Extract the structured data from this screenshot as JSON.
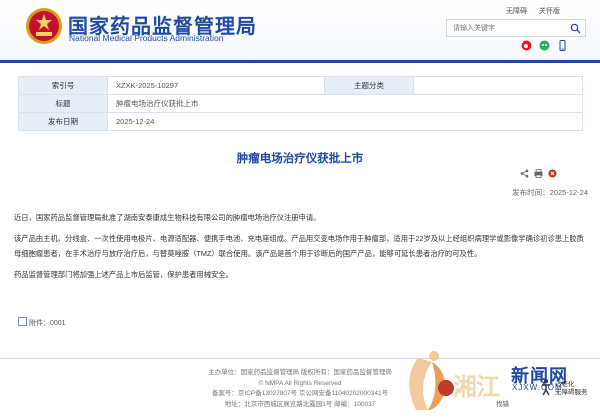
{
  "header": {
    "site_name": "国家药品监督管理局",
    "site_name_en": "National Medical Products Administration",
    "top_links": [
      "无障碍",
      "关怀版"
    ],
    "search_placeholder": "请输入关键字"
  },
  "info": {
    "rows": [
      {
        "label": "索引号",
        "value": "XZXK-2025-10297",
        "label2": "主题分类",
        "value2": ""
      },
      {
        "label": "标题",
        "value": "肿瘤电场治疗仪获批上市"
      },
      {
        "label": "发布日期",
        "value": "2025-12-24"
      }
    ]
  },
  "article": {
    "title": "肿瘤电场治疗仪获批上市",
    "date": "发布时间：2025-12-24",
    "p1": "近日，国家药品监督管理局批准了湖南安泰康成生物科技有限公司的肿瘤电场治疗仪注册申请。",
    "p2": "该产品由主机、分线盒、一次性使用电极片、电源适配器、便携手电池、充电座组成。产品用交变电场作用于肿瘤部，适用于22岁及以上经组织病理学或影像学确诊初诊患上胶质母细胞瘤患者，在手术治疗与放疗治疗后，与替莫唑胺（TMZ）联合使用。该产品是首个用于诊断后的国产产品，能够可延长患者治疗的可及性。",
    "p3": "药品监督管理部门将加强上述产品上市后监管，保护患者用械安全。",
    "attachment": "附件：0001"
  },
  "footer": {
    "line1": "主办单位：国家药品监督管理局 版权所有：国家药品监督管理局",
    "line2": "© NMPA All Rights Reserved",
    "line3": "备案号：京ICP备13027807号   京公网安备11040202000341号",
    "line4": "地址：北京市西城区展览路北露园1号 邮编：100037",
    "badge_line1": "政府网站",
    "badge_line2": "找错",
    "care_line1": "适老化",
    "care_line2": "无障碍服务"
  },
  "watermark": {
    "cn": "湘江",
    "news": "新闻网",
    "en": "XJXW.COM"
  },
  "colors": {
    "brand_blue": "#1f4aa0",
    "label_bg": "#e7eef8"
  }
}
